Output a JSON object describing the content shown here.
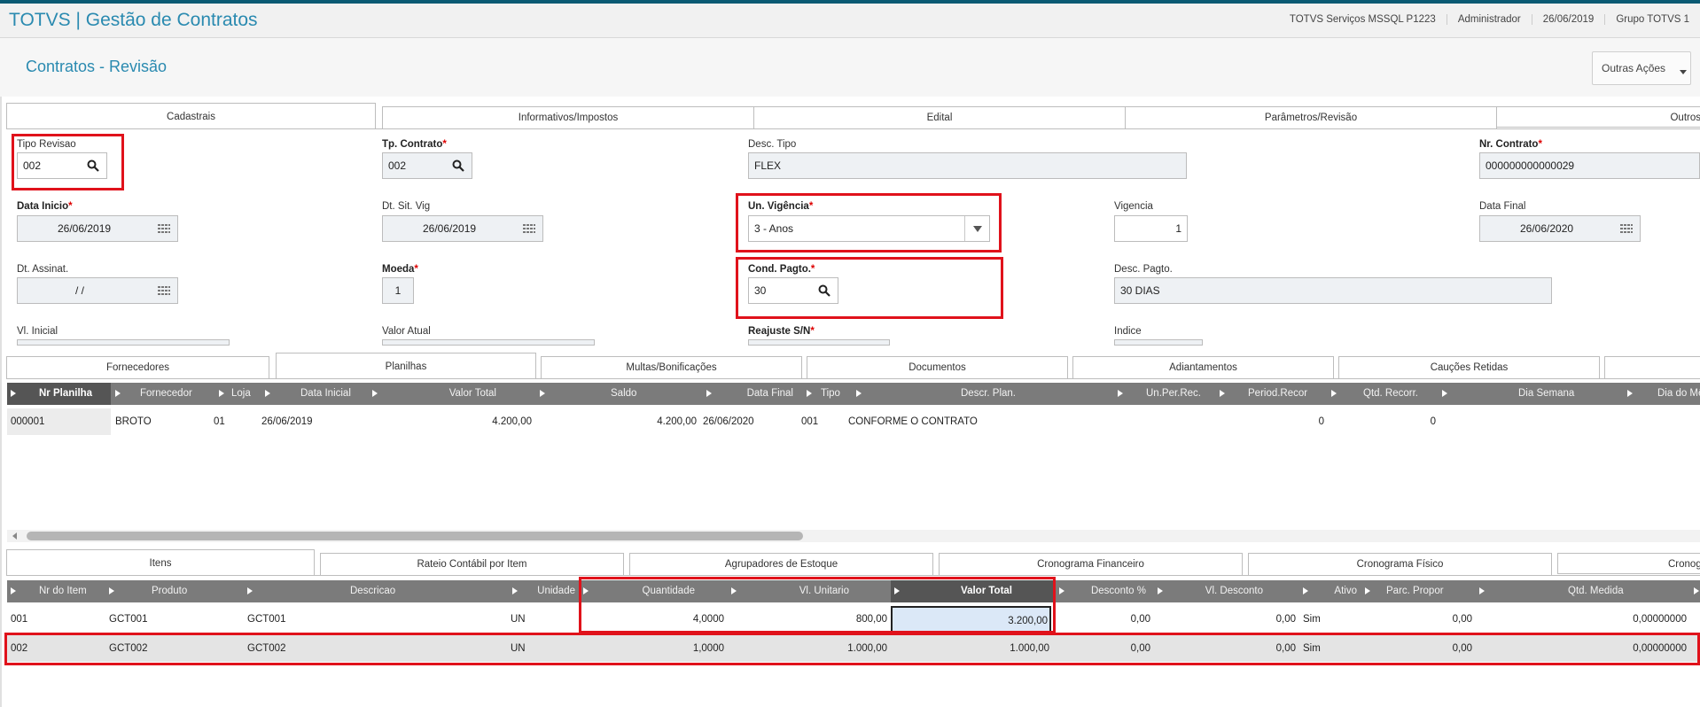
{
  "app": {
    "title": "TOTVS | Gestão de Contratos",
    "environment": "TOTVS Serviços MSSQL P1223",
    "user": "Administrador",
    "date": "26/06/2019",
    "group": "Grupo TOTVS 1"
  },
  "page": {
    "title": "Contratos - Revisão",
    "more_actions": "Outras Ações"
  },
  "form_tabs": [
    "Cadastrais",
    "Informativos/Impostos",
    "Edital",
    "Parâmetros/Revisão",
    "Outros"
  ],
  "fields": {
    "tipo_revisao": {
      "label": "Tipo Revisao",
      "value": "002"
    },
    "tp_contrato": {
      "label": "Tp. Contrato",
      "value": "002"
    },
    "desc_tipo": {
      "label": "Desc. Tipo",
      "value": "FLEX"
    },
    "nr_contrato": {
      "label": "Nr. Contrato",
      "value": "000000000000029"
    },
    "data_inicio": {
      "label": "Data Inicio",
      "value": "26/06/2019"
    },
    "dt_sit_vig": {
      "label": "Dt. Sit. Vig",
      "value": "26/06/2019"
    },
    "un_vigencia": {
      "label": "Un. Vigência",
      "value": "3 - Anos"
    },
    "vigencia": {
      "label": "Vigencia",
      "value": "1"
    },
    "data_final": {
      "label": "Data Final",
      "value": "26/06/2020"
    },
    "dt_assinat": {
      "label": "Dt. Assinat.",
      "value": " /  /"
    },
    "moeda": {
      "label": "Moeda",
      "value": "1"
    },
    "cond_pagto": {
      "label": "Cond. Pagto.",
      "value": "30"
    },
    "desc_pagto": {
      "label": "Desc. Pagto.",
      "value": "30 DIAS"
    },
    "vl_inicial": {
      "label": "Vl. Inicial"
    },
    "valor_atual": {
      "label": "Valor Atual"
    },
    "reajuste": {
      "label": "Reajuste S/N"
    },
    "indice": {
      "label": "Indice"
    }
  },
  "mid_tabs": [
    "Fornecedores",
    "Planilhas",
    "Multas/Bonificações",
    "Documentos",
    "Adiantamentos",
    "Cauções Retidas",
    ""
  ],
  "planilhas": {
    "columns": [
      "Nr Planilha",
      "Fornecedor",
      "Loja",
      "Data Inicial",
      "Valor Total",
      "Saldo",
      "Data Final",
      "Tipo",
      "Descr. Plan.",
      "Un.Per.Rec.",
      "Period.Recor",
      "Qtd. Recorr.",
      "Dia Semana",
      "Dia do Mês"
    ],
    "rows": [
      [
        "000001",
        "BROTO",
        "01",
        "26/06/2019",
        "4.200,00",
        "4.200,00",
        "26/06/2020",
        "001",
        "CONFORME O CONTRATO",
        "",
        "0",
        "0",
        "",
        ""
      ]
    ]
  },
  "bottom_tabs": [
    "Itens",
    "Rateio Contábil por Item",
    "Agrupadores de Estoque",
    "Cronograma Financeiro",
    "Cronograma Físico",
    "Cronograma"
  ],
  "itens": {
    "columns": [
      "Nr do Item",
      "Produto",
      "Descricao",
      "Unidade",
      "Quantidade",
      "Vl. Unitario",
      "Valor Total",
      "Desconto %",
      "Vl. Desconto",
      "Ativo",
      "Parc. Propor",
      "Qtd. Medida",
      ""
    ],
    "rows": [
      [
        "001",
        "GCT001",
        "GCT001",
        "UN",
        "4,0000",
        "800,00",
        "3.200,00",
        "0,00",
        "0,00",
        "Sim",
        "0,00",
        "0,00000000"
      ],
      [
        "002",
        "GCT002",
        "GCT002",
        "UN",
        "1,0000",
        "1.000,00",
        "1.000,00",
        "0,00",
        "0,00",
        "Sim",
        "0,00",
        "0,00000000"
      ]
    ]
  }
}
